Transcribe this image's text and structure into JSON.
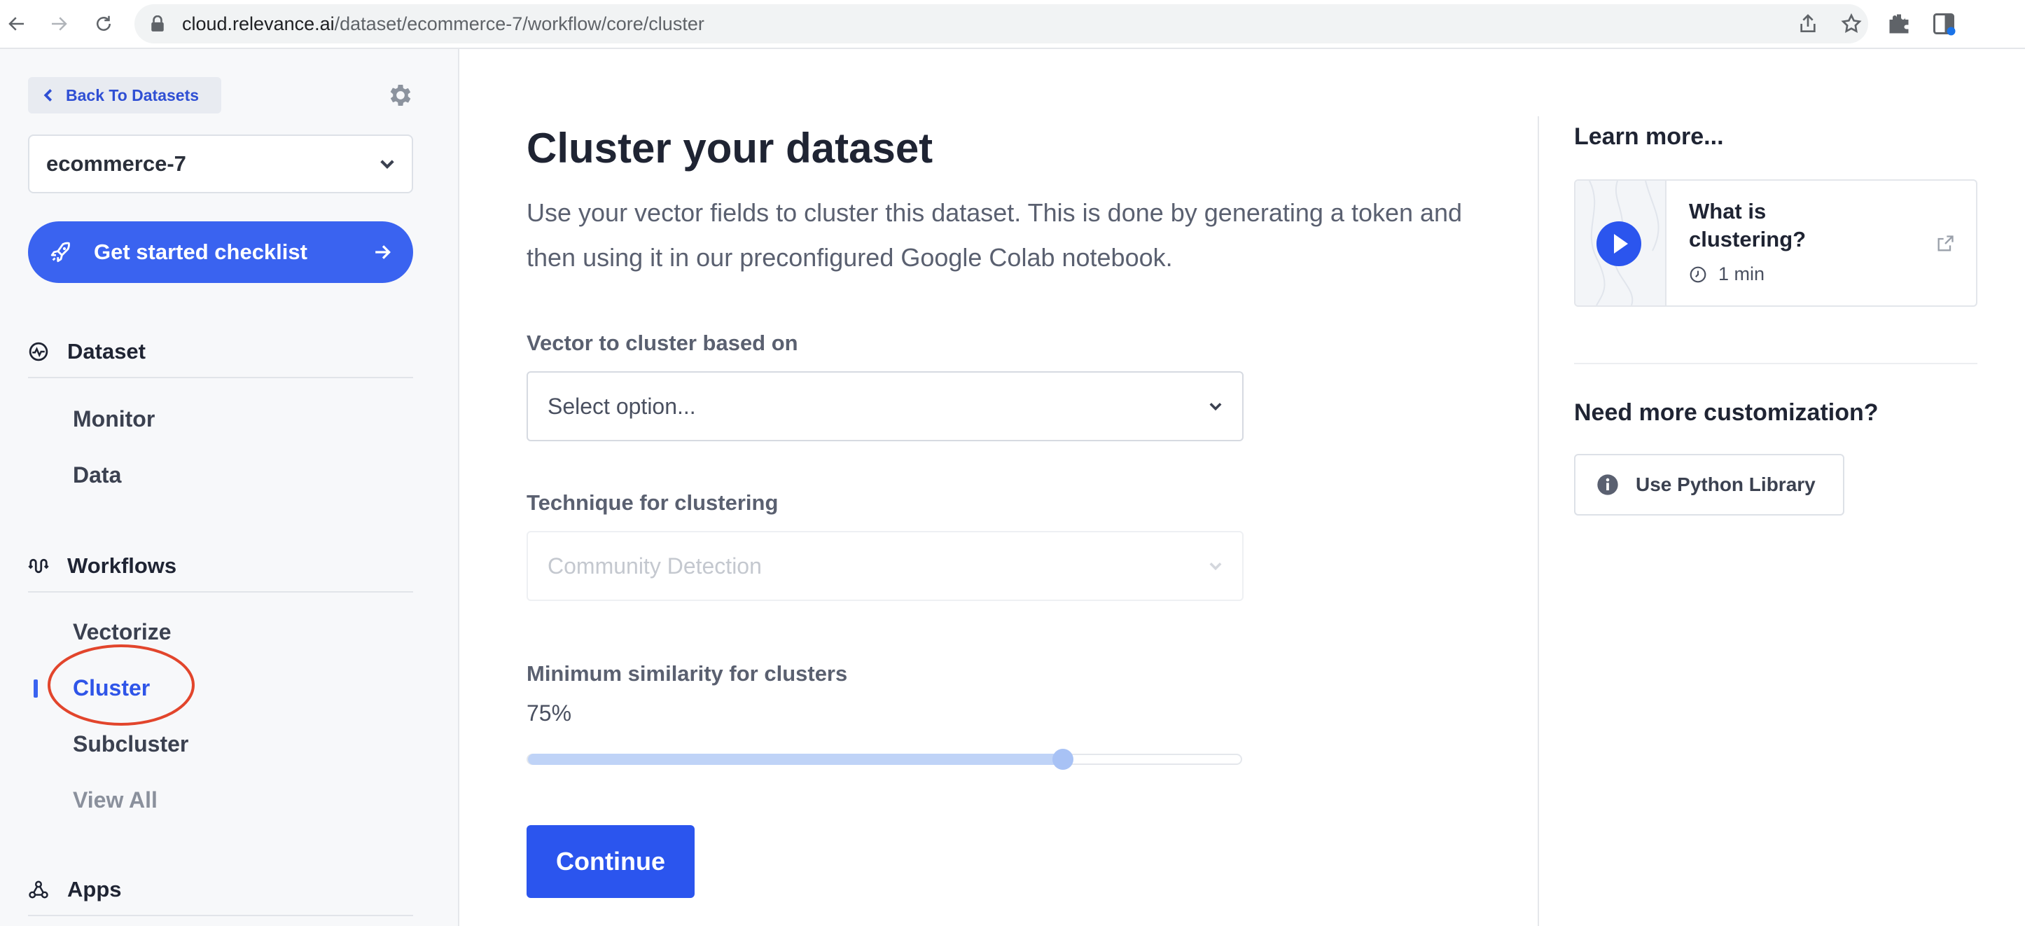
{
  "browser": {
    "url_host": "cloud.relevance.ai",
    "url_path": "/dataset/ecommerce-7/workflow/core/cluster"
  },
  "sidebar": {
    "back_label": "Back To Datasets",
    "dataset_name": "ecommerce-7",
    "checklist_label": "Get started checklist",
    "sections": {
      "dataset": {
        "label": "Dataset",
        "items": [
          "Monitor",
          "Data"
        ]
      },
      "workflows": {
        "label": "Workflows",
        "items": [
          "Vectorize",
          "Cluster",
          "Subcluster",
          "View All"
        ],
        "active": "Cluster"
      },
      "apps": {
        "label": "Apps"
      }
    }
  },
  "main": {
    "title": "Cluster your dataset",
    "description": "Use your vector fields to cluster this dataset. This is done by generating a token and then using it in our preconfigured Google Colab notebook.",
    "vector_field": {
      "label": "Vector to cluster based on",
      "placeholder": "Select option..."
    },
    "technique_field": {
      "label": "Technique for clustering",
      "value": "Community Detection",
      "disabled": true
    },
    "similarity_field": {
      "label": "Minimum similarity for clusters",
      "value_text": "75%",
      "value": 0.75
    },
    "continue_label": "Continue"
  },
  "right_panel": {
    "learn_more_title": "Learn more...",
    "video": {
      "title": "What is clustering?",
      "duration": "1 min"
    },
    "customization_title": "Need more customization?",
    "python_button_label": "Use Python Library"
  },
  "colors": {
    "accent": "#3a63f0",
    "button_primary": "#2b55ee",
    "annotation": "#e2452c"
  }
}
